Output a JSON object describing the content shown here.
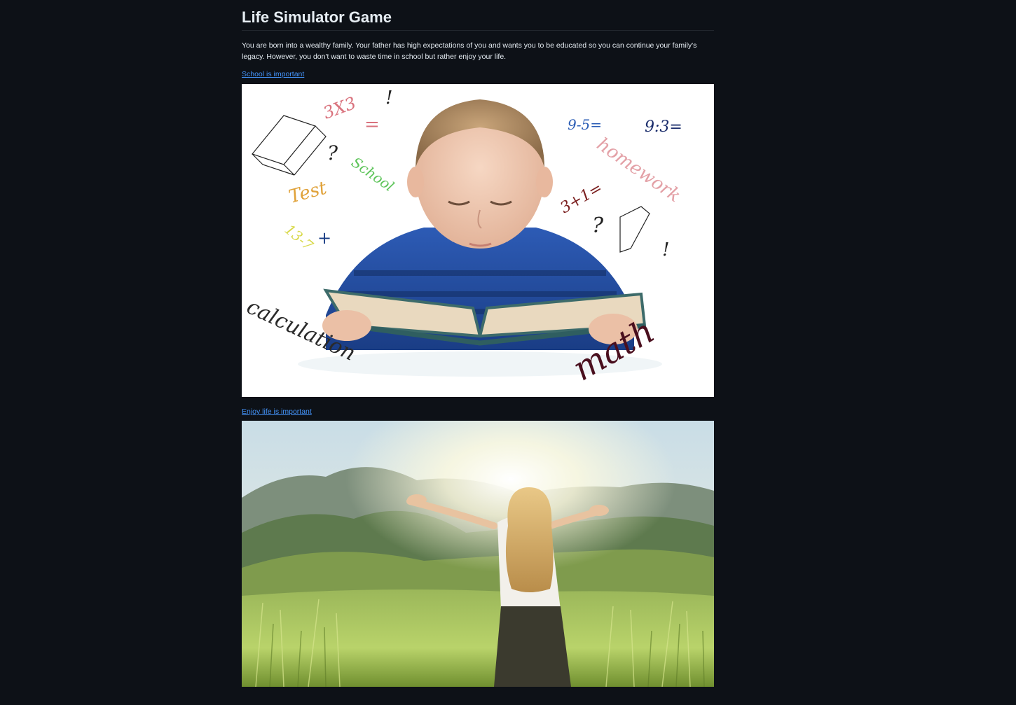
{
  "page": {
    "title": "Life Simulator Game",
    "intro": "You are born into a wealthy family. Your father has high expectations of you and wants you to be educated so you can continue your family's legacy. However, you don't want to waste time in school but rather enjoy your life."
  },
  "choices": [
    {
      "label": "School is important",
      "image_texts": [
        "3X3",
        "=",
        "!",
        "?",
        "School",
        "Test",
        "13-7",
        "+",
        "9-5=",
        "9:3=",
        "homework",
        "3+1=",
        "?",
        "!",
        "calculation",
        "math"
      ]
    },
    {
      "label": "Enjoy life is important"
    }
  ],
  "colors": {
    "background": "#0d1117",
    "text": "#e6edf3",
    "link": "#4493f8"
  }
}
